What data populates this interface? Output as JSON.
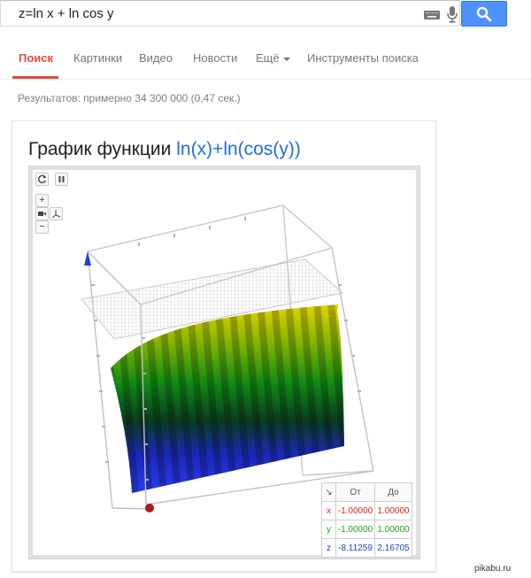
{
  "search": {
    "query": "z=ln x + ln cos y",
    "button_label": "search"
  },
  "tabs": [
    {
      "label": "Поиск",
      "active": true
    },
    {
      "label": "Картинки"
    },
    {
      "label": "Видео"
    },
    {
      "label": "Новости"
    },
    {
      "label": "Ещё"
    },
    {
      "label": "Инструменты поиска"
    }
  ],
  "results_stats": "Результатов: примерно 34 300 000 (0,47 сек.)",
  "card": {
    "title_prefix": "График функции ",
    "function": "ln(x)+ln(cos(y))"
  },
  "plot_controls": {
    "reset_icon": "refresh-icon",
    "pause_icon": "pause-icon",
    "zoom_in": "+",
    "zoom_out": "−",
    "camera_icon": "camera-icon",
    "axes_icon": "axes-icon"
  },
  "range_table": {
    "corner": "↘",
    "headers": [
      "От",
      "До"
    ],
    "rows": [
      {
        "var": "x",
        "from": "-1.00000",
        "to": "1.00000",
        "color": "#dd2222"
      },
      {
        "var": "y",
        "from": "-1.00000",
        "to": "1.00000",
        "color": "#1fa01f"
      },
      {
        "var": "z",
        "from": "-8.11259",
        "to": "2.16705",
        "color": "#2244cc"
      }
    ]
  },
  "colors": {
    "accent_red": "#dd4b39",
    "search_blue": "#4d90fe",
    "surface_top": "#e0c800",
    "surface_mid": "#1a8a00",
    "surface_bottom": "#1a2ad8"
  },
  "watermark": "pikabu.ru"
}
